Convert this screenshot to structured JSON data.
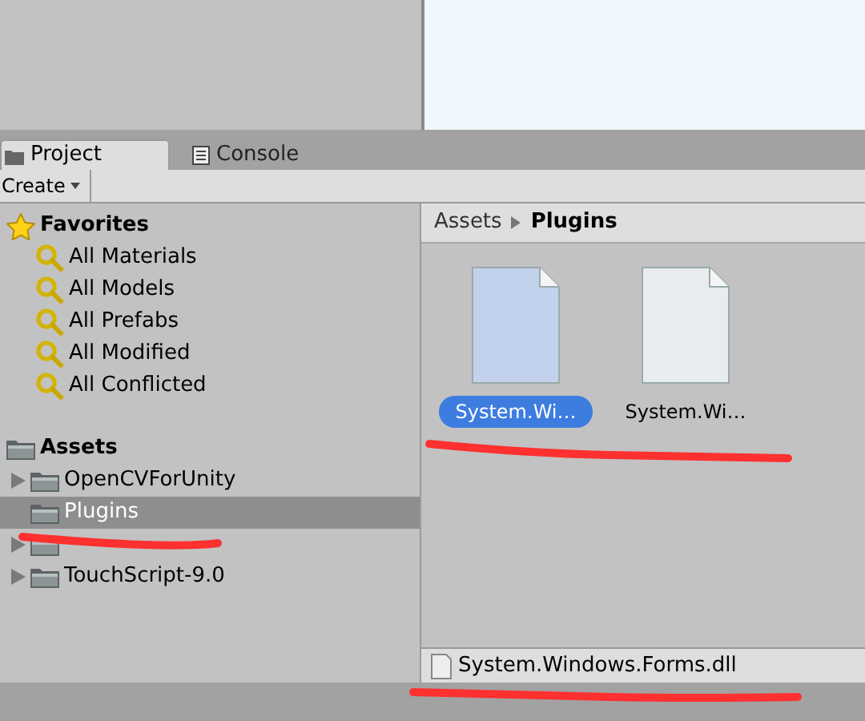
{
  "tabs": [
    {
      "label": "Project",
      "selected": true
    },
    {
      "label": "Console",
      "selected": false
    }
  ],
  "toolbar": {
    "create_button": "Create"
  },
  "sidebar": {
    "favorites": {
      "label": "Favorites",
      "children": [
        {
          "label": "All Materials"
        },
        {
          "label": "All Models"
        },
        {
          "label": "All Prefabs"
        },
        {
          "label": "All Modified"
        },
        {
          "label": "All Conflicted"
        }
      ]
    },
    "assets": {
      "label": "Assets",
      "children": [
        {
          "label": "OpenCVForUnity",
          "has_children": true,
          "selected": false
        },
        {
          "label": "Plugins",
          "has_children": false,
          "selected": true
        },
        {
          "has_children": true,
          "selected": false
        },
        {
          "label": "TouchScript-9.0",
          "has_children": true,
          "selected": false
        }
      ]
    }
  },
  "breadcrumb": [
    "Assets",
    "Plugins"
  ],
  "files": [
    {
      "name": "System.Wi…",
      "selected": true
    },
    {
      "name": "System.Wi…",
      "selected": false
    }
  ],
  "status_bar": {
    "file": "System.Windows.Forms.dll"
  }
}
